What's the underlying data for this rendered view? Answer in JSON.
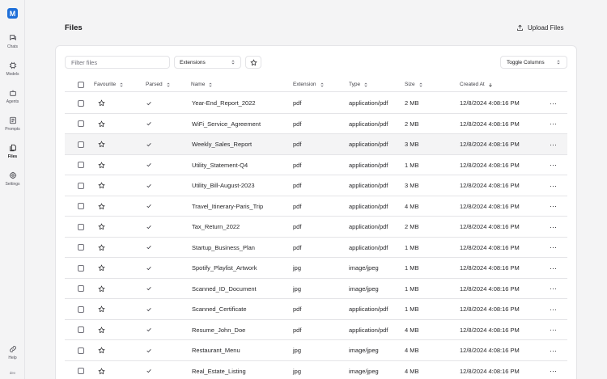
{
  "sidebar": {
    "logo": "M",
    "items": [
      {
        "label": "Chats",
        "icon": "chat-icon"
      },
      {
        "label": "Models",
        "icon": "models-icon"
      },
      {
        "label": "Agents",
        "icon": "agents-icon"
      },
      {
        "label": "Prompts",
        "icon": "prompts-icon"
      },
      {
        "label": "Files",
        "icon": "files-icon",
        "active": true
      },
      {
        "label": "Settings",
        "icon": "settings-icon"
      }
    ],
    "help": "Help",
    "env": "dev"
  },
  "header": {
    "title": "Files",
    "upload_label": "Upload Files"
  },
  "toolbar": {
    "filter_placeholder": "Filter files",
    "extensions_label": "Extensions",
    "toggle_columns_label": "Toggle Columns"
  },
  "table": {
    "columns": {
      "favourite": "Favourite",
      "parsed": "Parsed",
      "name": "Name",
      "extension": "Extension",
      "type": "Type",
      "size": "Size",
      "created": "Created At"
    },
    "rows": [
      {
        "name": "Year-End_Report_2022",
        "ext": "pdf",
        "type": "application/pdf",
        "size": "2 MB",
        "created": "12/8/2024 4:08:16 PM"
      },
      {
        "name": "WiFi_Service_Agreement",
        "ext": "pdf",
        "type": "application/pdf",
        "size": "2 MB",
        "created": "12/8/2024 4:08:16 PM"
      },
      {
        "name": "Weekly_Sales_Report",
        "ext": "pdf",
        "type": "application/pdf",
        "size": "3 MB",
        "created": "12/8/2024 4:08:16 PM"
      },
      {
        "name": "Utility_Statement-Q4",
        "ext": "pdf",
        "type": "application/pdf",
        "size": "1 MB",
        "created": "12/8/2024 4:08:16 PM"
      },
      {
        "name": "Utility_Bill-August-2023",
        "ext": "pdf",
        "type": "application/pdf",
        "size": "3 MB",
        "created": "12/8/2024 4:08:16 PM"
      },
      {
        "name": "Travel_Itinerary-Paris_Trip",
        "ext": "pdf",
        "type": "application/pdf",
        "size": "4 MB",
        "created": "12/8/2024 4:08:16 PM"
      },
      {
        "name": "Tax_Return_2022",
        "ext": "pdf",
        "type": "application/pdf",
        "size": "2 MB",
        "created": "12/8/2024 4:08:16 PM"
      },
      {
        "name": "Startup_Business_Plan",
        "ext": "pdf",
        "type": "application/pdf",
        "size": "1 MB",
        "created": "12/8/2024 4:08:16 PM"
      },
      {
        "name": "Spotify_Playlist_Artwork",
        "ext": "jpg",
        "type": "image/jpeg",
        "size": "1 MB",
        "created": "12/8/2024 4:08:16 PM"
      },
      {
        "name": "Scanned_ID_Document",
        "ext": "jpg",
        "type": "image/jpeg",
        "size": "1 MB",
        "created": "12/8/2024 4:08:16 PM"
      },
      {
        "name": "Scanned_Certificate",
        "ext": "pdf",
        "type": "application/pdf",
        "size": "1 MB",
        "created": "12/8/2024 4:08:16 PM"
      },
      {
        "name": "Resume_John_Doe",
        "ext": "pdf",
        "type": "application/pdf",
        "size": "4 MB",
        "created": "12/8/2024 4:08:16 PM"
      },
      {
        "name": "Restaurant_Menu",
        "ext": "jpg",
        "type": "image/jpeg",
        "size": "4 MB",
        "created": "12/8/2024 4:08:16 PM"
      },
      {
        "name": "Real_Estate_Listing",
        "ext": "jpg",
        "type": "image/jpeg",
        "size": "4 MB",
        "created": "12/8/2024 4:08:16 PM"
      }
    ],
    "row_menu_glyph": "···"
  },
  "colors": {
    "accent": "#1e6fd9",
    "border": "#e4e4e7",
    "hover_row": "#f4f4f5"
  }
}
